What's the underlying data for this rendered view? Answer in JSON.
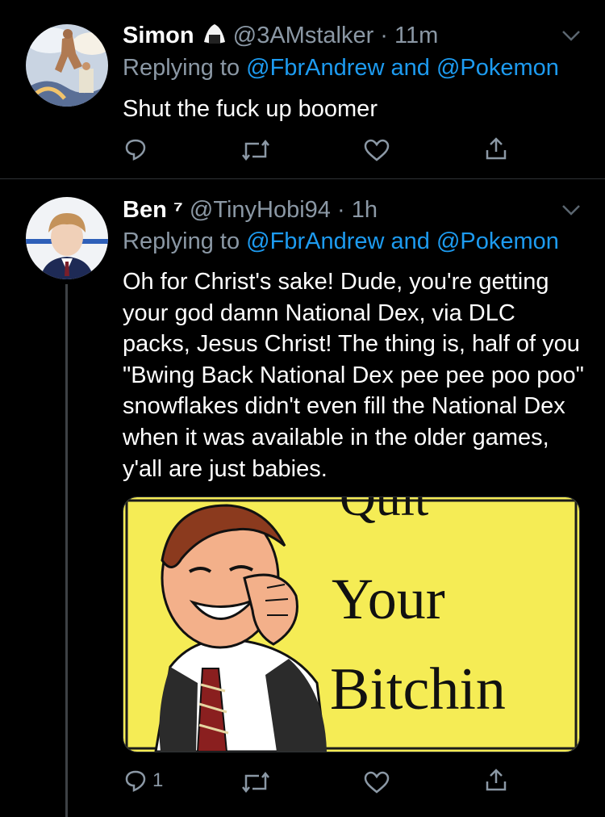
{
  "tweets": [
    {
      "name": "Simon",
      "handle": "@3AMstalker",
      "separator": "·",
      "time": "11m",
      "replying_prefix": "Replying to",
      "reply_user1": "@FbrAndrew",
      "reply_and": "and",
      "reply_user2": "@Pokemon",
      "text": "Shut the fuck up boomer",
      "reply_count": ""
    },
    {
      "name": "Ben",
      "name_suffix": "⁷",
      "handle": "@TinyHobi94",
      "separator": "·",
      "time": "1h",
      "replying_prefix": "Replying to",
      "reply_user1": "@FbrAndrew",
      "reply_and": "and",
      "reply_user2": "@Pokemon",
      "text": "Oh for Christ's sake! Dude, you're getting your god damn National Dex, via DLC packs, Jesus Christ! The thing is, half of you \"Bwing Back National Dex pee pee poo poo\" snowflakes didn't even fill the National Dex when it was available in the older games, y'all are just babies.",
      "reply_count": "1",
      "media": {
        "line1": "Quit",
        "line2": "Your",
        "line3": "Bitchin",
        "bg": "#f5ec55"
      }
    }
  ],
  "colors": {
    "background": "#000000",
    "secondary_text": "#8b98a5",
    "link": "#1d9bf0",
    "divider": "#2f3336"
  }
}
